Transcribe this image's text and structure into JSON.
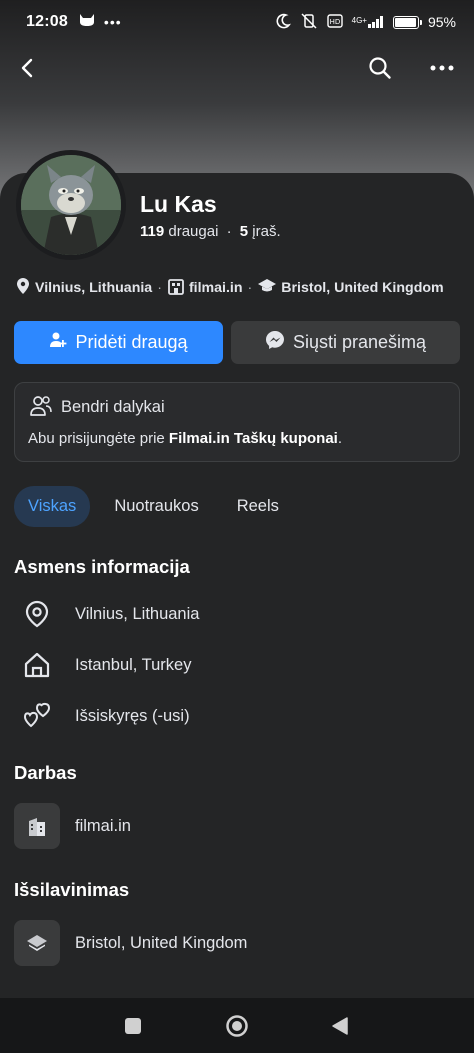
{
  "status_bar": {
    "time": "12:08",
    "left_icons": [
      "cat-icon",
      "more-dots-icon"
    ],
    "network": "4G+",
    "battery_percent": "95%",
    "battery_level": 0.95
  },
  "nav": {
    "back_icon": "back-arrow-icon",
    "search_icon": "search-icon",
    "more_icon": "more-horizontal-icon"
  },
  "profile": {
    "name": "Lu Kas",
    "friends_count": "119",
    "friends_label": "draugai",
    "separator": "·",
    "posts_count": "5",
    "posts_label": "įraš."
  },
  "info_line": {
    "location": "Vilnius, Lithuania",
    "work": "filmai.in",
    "education": "Bristol, United Kingdom",
    "dot": "·"
  },
  "actions": {
    "add_friend": "Pridėti draugą",
    "message": "Siųsti pranešimą"
  },
  "mutual": {
    "title": "Bendri dalykai",
    "text_prefix": "Abu prisijungėte prie ",
    "text_bold": "Filmai.in Taškų kuponai",
    "text_suffix": "."
  },
  "tabs": [
    {
      "label": "Viskas",
      "active": true
    },
    {
      "label": "Nuotraukos",
      "active": false
    },
    {
      "label": "Reels",
      "active": false
    }
  ],
  "personal": {
    "title": "Asmens informacija",
    "items": [
      {
        "icon": "location-pin-icon",
        "label": "Vilnius, Lithuania"
      },
      {
        "icon": "home-icon",
        "label": "Istanbul, Turkey"
      },
      {
        "icon": "hearts-icon",
        "label": "Išsiskyręs (-usi)"
      }
    ]
  },
  "work": {
    "title": "Darbas",
    "item": {
      "icon": "building-icon",
      "label": "filmai.in"
    }
  },
  "education": {
    "title": "Išsilavinimas",
    "item": {
      "icon": "graduation-cap-icon",
      "label": "Bristol, United Kingdom"
    }
  },
  "colors": {
    "accent": "#2d88ff",
    "background": "#242526",
    "tab_active_bg": "#263951",
    "tab_active_text": "#4da3ff"
  }
}
